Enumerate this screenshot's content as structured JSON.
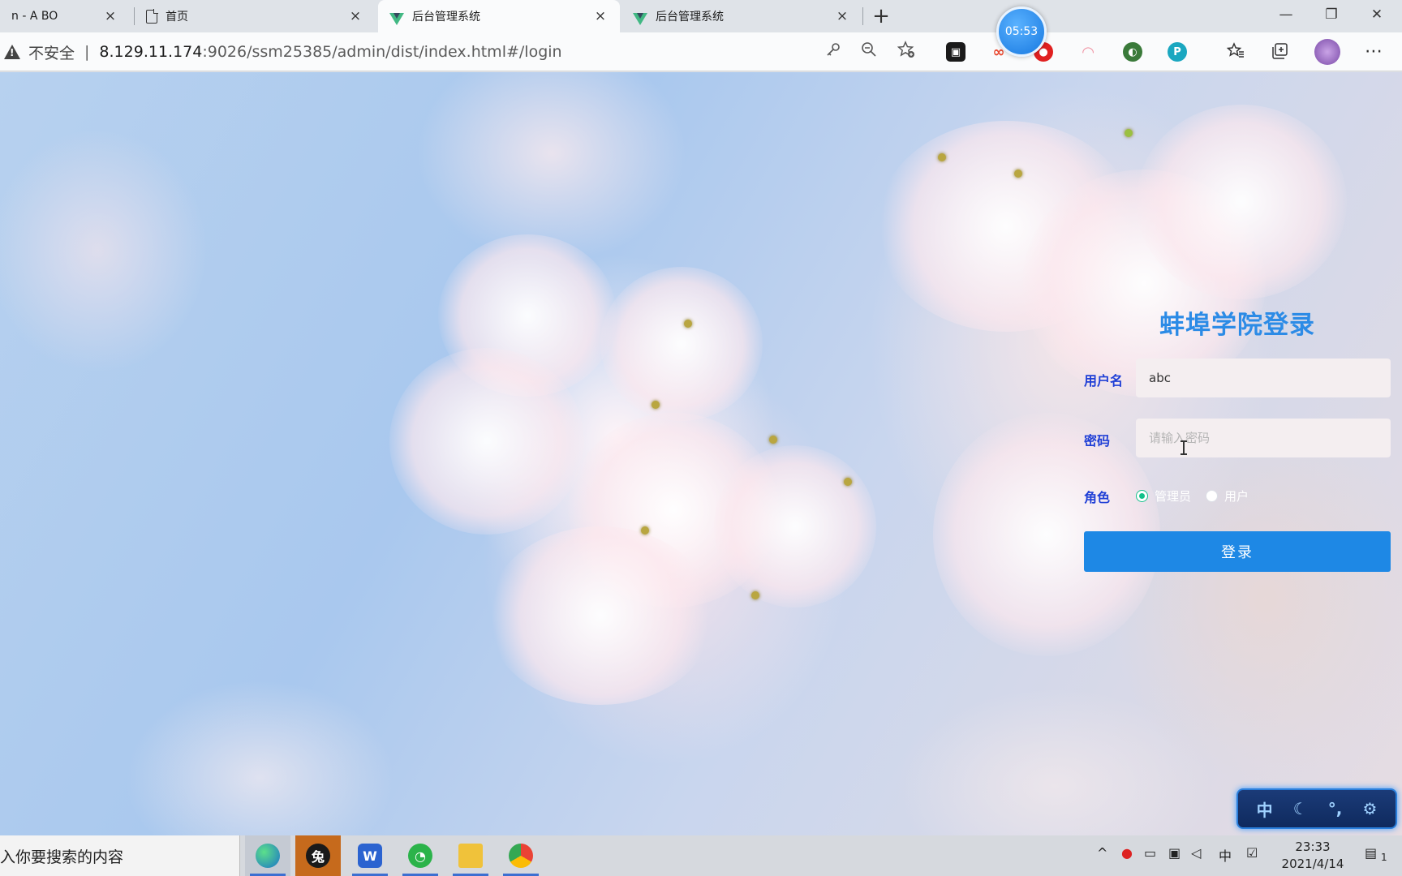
{
  "browser": {
    "tabs": [
      {
        "title": "n - A BO",
        "close": "×"
      },
      {
        "title": "首页",
        "close": "×"
      },
      {
        "title": "后台管理系统",
        "close": "×",
        "active": true
      },
      {
        "title": "后台管理系统",
        "close": "×"
      }
    ],
    "new_tab": "+",
    "window_controls": {
      "minimize": "—",
      "restore": "❐",
      "close": "✕"
    },
    "address": {
      "security_label": "不安全",
      "separator": "|",
      "url_host": "8.129.11.174",
      "url_rest": ":9026/ssm25385/admin/dist/index.html#/login"
    },
    "timer": "05:53",
    "icons": {
      "key": "key-icon",
      "zoom": "zoom-out-icon",
      "favorite_add": "star-add-icon",
      "favorites": "favorites-icon",
      "collections": "collections-icon",
      "profile": "avatar",
      "more": "more-icon"
    }
  },
  "login": {
    "title": "蚌埠学院登录",
    "username_label": "用户名",
    "username_value": "abc",
    "password_label": "密码",
    "password_placeholder": "请输入密码",
    "role_label": "角色",
    "roles": [
      "管理员",
      "用户"
    ],
    "selected_role": "管理员",
    "submit_label": "登录"
  },
  "ime": {
    "mode": "中",
    "moon": "☾",
    "punct": "°,",
    "settings": "⚙"
  },
  "taskbar": {
    "search_placeholder": "入你要搜索的内容",
    "tray_lang": "中",
    "time": "23:33",
    "date": "2021/4/14",
    "notification_count": "1"
  },
  "colors": {
    "accent": "#1e88e5",
    "title": "#2c8be6",
    "label": "#1f3fd6",
    "radio_checked": "#13c08a"
  }
}
